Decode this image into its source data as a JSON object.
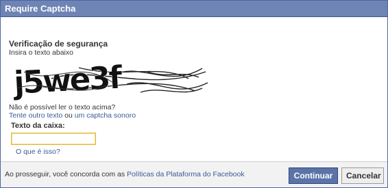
{
  "dialog": {
    "title": "Require Captcha",
    "heading": "Verificação de segurança",
    "instruction": "Insira o texto abaixo",
    "captcha_text": "j5we3f",
    "cant_read": "Não é possível ler o texto acima?",
    "try_other": "Tente outro texto",
    "or": " ou ",
    "audio": "um captcha sonoro",
    "field_label": "Texto da caixa:",
    "input_value": "",
    "what_is": "O que é isso?"
  },
  "footer": {
    "agree_prefix": "Ao prosseguir, você concorda com as ",
    "policy_link": "Políticas da Plataforma do Facebook",
    "continue_label": "Continuar",
    "cancel_label": "Cancelar"
  },
  "colors": {
    "titlebar": "#6d84b4",
    "link": "#3b5998",
    "primary_button": "#5b74a8"
  }
}
